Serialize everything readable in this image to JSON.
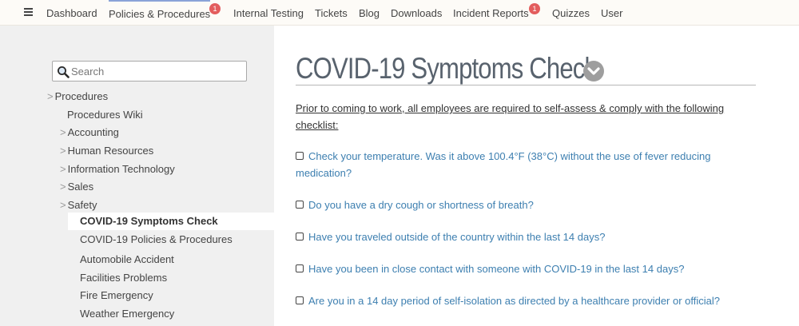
{
  "nav": {
    "items": [
      {
        "label": "Dashboard"
      },
      {
        "label": "Policies & Procedures",
        "badge": "1"
      },
      {
        "label": "Internal Testing"
      },
      {
        "label": "Tickets"
      },
      {
        "label": "Blog"
      },
      {
        "label": "Downloads"
      },
      {
        "label": "Incident Reports",
        "badge": "1"
      },
      {
        "label": "Quizzes"
      },
      {
        "label": "User"
      }
    ]
  },
  "sidebar": {
    "search_placeholder": "Search",
    "tree": [
      {
        "label": "Procedures",
        "arrow": ">"
      },
      {
        "label": "Procedures Wiki"
      },
      {
        "label": "Accounting",
        "arrow": ">"
      },
      {
        "label": "Human Resources",
        "arrow": ">"
      },
      {
        "label": "Information Technology",
        "arrow": ">"
      },
      {
        "label": "Sales",
        "arrow": ">"
      },
      {
        "label": "Safety",
        "arrow": ">"
      },
      {
        "label": "COVID-19 Symptoms Check"
      },
      {
        "label": "COVID-19 Policies & Procedures"
      },
      {
        "label": "Automobile Accident"
      },
      {
        "label": "Facilities Problems"
      },
      {
        "label": "Fire Emergency"
      },
      {
        "label": "Weather Emergency"
      }
    ]
  },
  "main": {
    "title": "COVID-19 Symptoms Check",
    "intro": "Prior to coming to work, all employees are required to self-assess & comply with the following checklist:",
    "checklist": [
      {
        "text": "Check your temperature. Was it above 100.4°F (38°C) without the use of fever reducing medication?"
      },
      {
        "text": "Do you have a dry cough or shortness of breath?"
      },
      {
        "text": "Have you traveled outside of the country within the last 14 days?"
      },
      {
        "text": "Have you been in close contact with someone with COVID-19 in the last 14 days?"
      },
      {
        "text": "Are you in a 14 day period of self-isolation as directed by a healthcare provider or official?"
      }
    ]
  },
  "colors": {
    "badge": "#e35d5d",
    "link": "#3d7fb0",
    "title": "#58626d",
    "sidebar_bg": "#f0f0f0"
  }
}
